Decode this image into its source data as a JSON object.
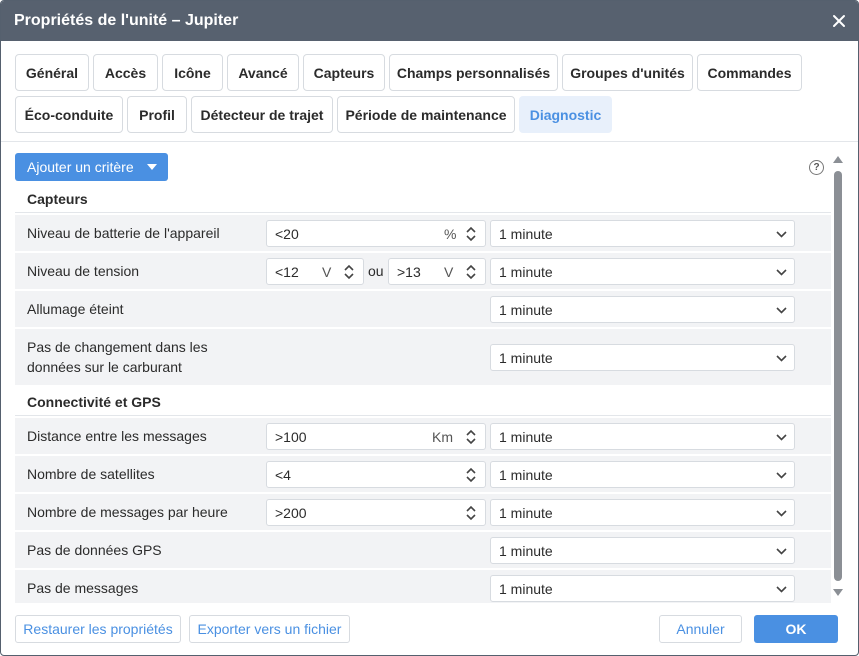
{
  "window": {
    "title": "Propriétés de l'unité – Jupiter"
  },
  "tabs": [
    {
      "label": "Général"
    },
    {
      "label": "Accès"
    },
    {
      "label": "Icône"
    },
    {
      "label": "Avancé"
    },
    {
      "label": "Capteurs"
    },
    {
      "label": "Champs personnalisés"
    },
    {
      "label": "Groupes d'unités"
    },
    {
      "label": "Commandes"
    },
    {
      "label": "Éco-conduite"
    },
    {
      "label": "Profil"
    },
    {
      "label": "Détecteur de trajet"
    },
    {
      "label": "Période de maintenance"
    },
    {
      "label": "Diagnostic",
      "active": true
    }
  ],
  "toolbar": {
    "add_criterion": "Ajouter un critère",
    "help_symbol": "?"
  },
  "sections": {
    "sensors": {
      "title": "Capteurs",
      "rows": [
        {
          "label": "Niveau de batterie de l'appareil",
          "value": "<20",
          "unit": "%",
          "period": "1 minute"
        },
        {
          "label": "Niveau de tension",
          "value": "<12",
          "unit": "V",
          "joiner": "ou",
          "value2": ">13",
          "unit2": "V",
          "period": "1 minute"
        },
        {
          "label": "Allumage éteint",
          "period": "1 minute"
        },
        {
          "label_line1": "Pas de changement dans les",
          "label_line2": "données sur le carburant",
          "period": "1 minute"
        }
      ]
    },
    "connectivity": {
      "title": "Connectivité et GPS",
      "rows": [
        {
          "label": "Distance entre les messages",
          "value": ">100",
          "unit": "Km",
          "period": "1 minute"
        },
        {
          "label": "Nombre de satellites",
          "value": "<4",
          "period": "1 minute"
        },
        {
          "label": "Nombre de messages par heure",
          "value": ">200",
          "period": "1 minute"
        },
        {
          "label": "Pas de données GPS",
          "period": "1 minute"
        },
        {
          "label": "Pas de messages",
          "period": "1 minute"
        }
      ]
    }
  },
  "footer": {
    "restore": "Restaurer les propriétés",
    "export": "Exporter vers un fichier",
    "cancel": "Annuler",
    "ok": "OK"
  },
  "colors": {
    "accent": "#4a90e2",
    "titlebar": "#57616f",
    "row_bg": "#f2f3f5",
    "active_tab_bg": "#e8f0fb"
  },
  "icons": {
    "close": "close-icon",
    "help": "help-icon",
    "dropdown": "chevron-down-icon",
    "spinner": "spinner-arrows-icon"
  }
}
